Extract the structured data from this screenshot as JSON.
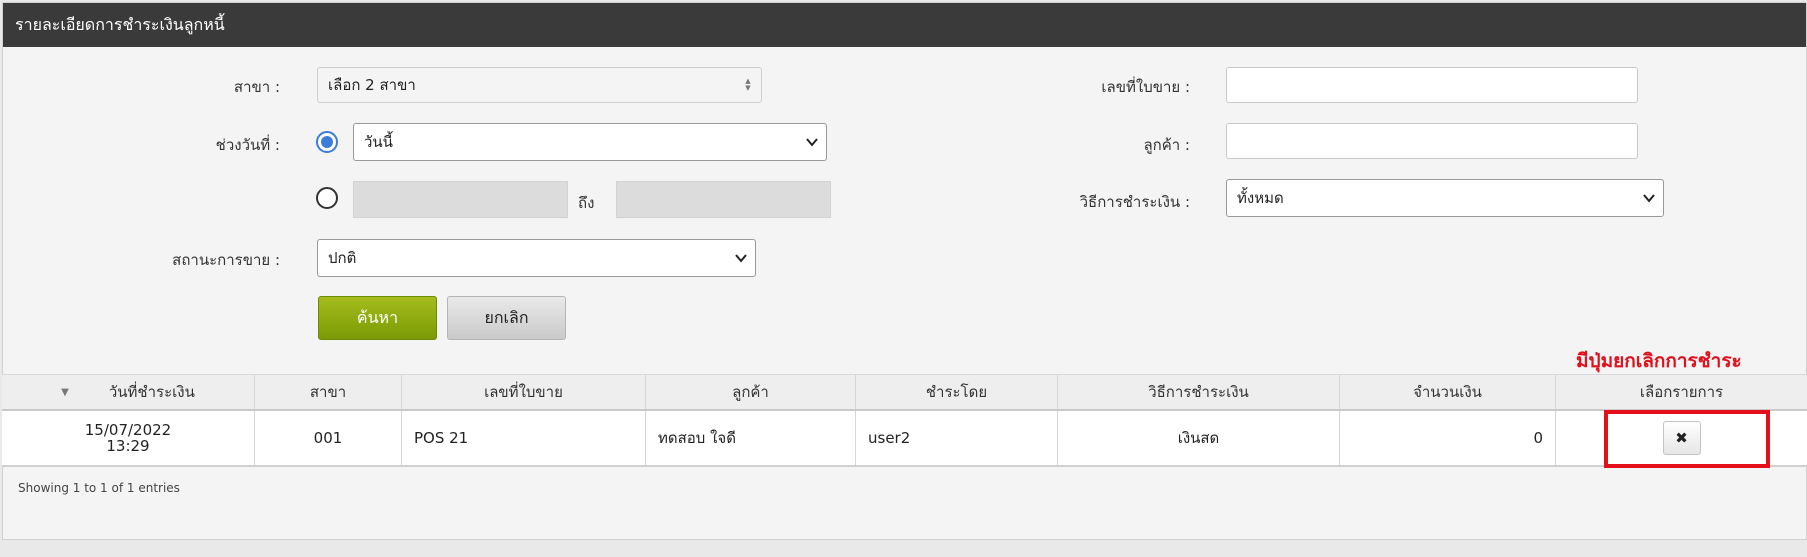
{
  "header": {
    "title": "รายละเอียดการชำระเงินลูกหนี้"
  },
  "form": {
    "branch_label": "สาขา :",
    "branch_value": "เลือก 2 สาขา",
    "date_range_label": "ช่วงวันที่ :",
    "date_preset_value": "วันนี้",
    "to_label": "ถึง",
    "sale_status_label": "สถานะการขาย :",
    "sale_status_value": "ปกติ",
    "invoice_label": "เลขที่ใบขาย :",
    "invoice_value": "",
    "customer_label": "ลูกค้า :",
    "customer_value": "",
    "payment_method_label": "วิธีการชำระเงิน :",
    "payment_method_value": "ทั้งหมด",
    "search_button": "ค้นหา",
    "cancel_button": "ยกเลิก"
  },
  "annotation": "มีปุ่มยกเลิกการชำระ",
  "table": {
    "columns": [
      "วันที่ชำระเงิน",
      "สาขา",
      "เลขที่ใบขาย",
      "ลูกค้า",
      "ชำระโดย",
      "วิธีการชำระเงิน",
      "จำนวนเงิน",
      "เลือกรายการ"
    ],
    "rows": [
      {
        "date": "15/07/2022",
        "time": "13:29",
        "branch": "001",
        "invoice": "POS 21",
        "customer": "ทดสอบ ใจดี",
        "paid_by": "user2",
        "method": "เงินสด",
        "amount": "0",
        "action": "✖"
      }
    ]
  },
  "footer": {
    "info": "Showing 1 to 1 of 1 entries"
  },
  "colors": {
    "header_bg": "#3a3a3a",
    "search_button": "#8aa70c",
    "annotation": "#e3101c",
    "radio_active": "#3b7dd8"
  }
}
